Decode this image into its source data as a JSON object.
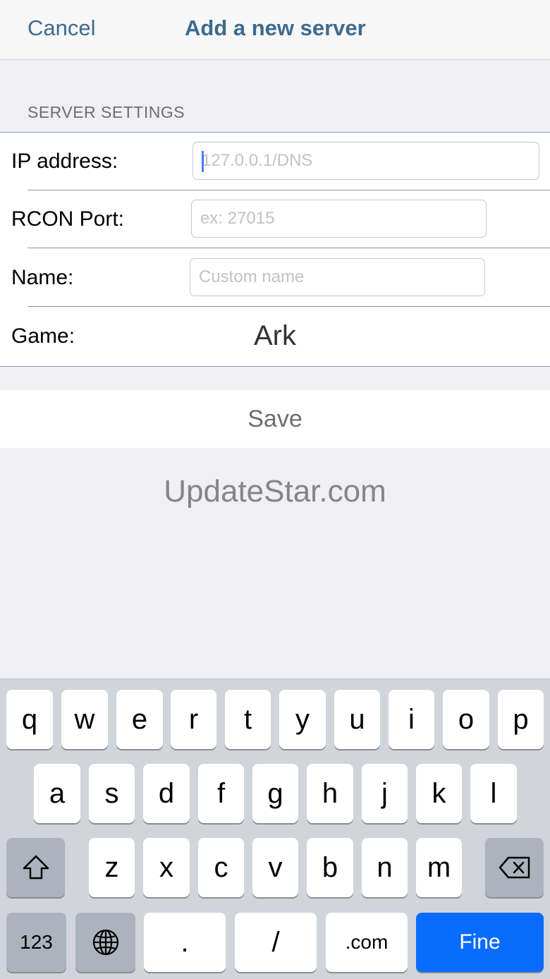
{
  "navbar": {
    "cancel_label": "Cancel",
    "title": "Add a new server"
  },
  "section_header": "SERVER SETTINGS",
  "fields": {
    "ip": {
      "label": "IP address:",
      "placeholder": "127.0.0.1/DNS",
      "value": ""
    },
    "port": {
      "label": "RCON Port:",
      "placeholder": "ex: 27015",
      "value": ""
    },
    "name": {
      "label": "Name:",
      "placeholder": "Custom name",
      "value": ""
    },
    "game": {
      "label": "Game:",
      "value": "Ark"
    }
  },
  "save_label": "Save",
  "watermark": "UpdateStar.com",
  "keyboard": {
    "row1": [
      "q",
      "w",
      "e",
      "r",
      "t",
      "y",
      "u",
      "i",
      "o",
      "p"
    ],
    "row2": [
      "a",
      "s",
      "d",
      "f",
      "g",
      "h",
      "j",
      "k",
      "l"
    ],
    "row3": [
      "z",
      "x",
      "c",
      "v",
      "b",
      "n",
      "m"
    ],
    "numbers_label": "123",
    "dot_label": ".",
    "slash_label": "/",
    "dotcom_label": ".com",
    "return_label": "Fine"
  },
  "colors": {
    "accent": "#3d6b8f",
    "return_key": "#0a6cff",
    "caret": "#4a7cff"
  }
}
